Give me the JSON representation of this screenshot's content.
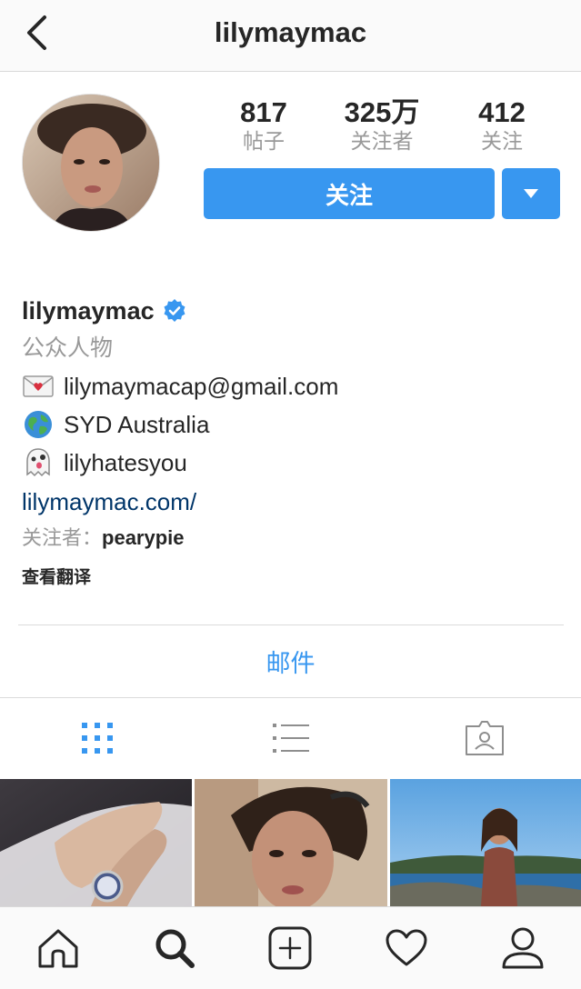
{
  "header": {
    "title": "lilymaymac",
    "back_icon": "chevron-left-icon"
  },
  "profile": {
    "stats": [
      {
        "value": "817",
        "label": "帖子"
      },
      {
        "value": "325万",
        "label": "关注者"
      },
      {
        "value": "412",
        "label": "关注"
      }
    ],
    "follow_label": "关注",
    "dropdown_icon": "caret-down-icon"
  },
  "bio": {
    "name": "lilymaymac",
    "verified": true,
    "category": "公众人物",
    "lines": [
      {
        "icon": "love-letter-icon",
        "text": "lilymaymacap@gmail.com"
      },
      {
        "icon": "globe-icon",
        "text": "SYD Australia"
      },
      {
        "icon": "ghost-icon",
        "text": "lilyhatesyou"
      }
    ],
    "website": "lilymaymac.com/",
    "followed_by_label": "关注者：",
    "followed_by_user": "pearypie",
    "see_translation": "查看翻译"
  },
  "contact": {
    "email_label": "邮件"
  },
  "view_tabs": [
    "grid-icon",
    "list-icon",
    "tagged-icon"
  ],
  "bottom_nav": [
    "home-icon",
    "search-icon",
    "add-icon",
    "heart-icon",
    "profile-icon"
  ],
  "colors": {
    "accent": "#3897f0",
    "link": "#003569",
    "muted": "#999999",
    "text": "#262626"
  }
}
